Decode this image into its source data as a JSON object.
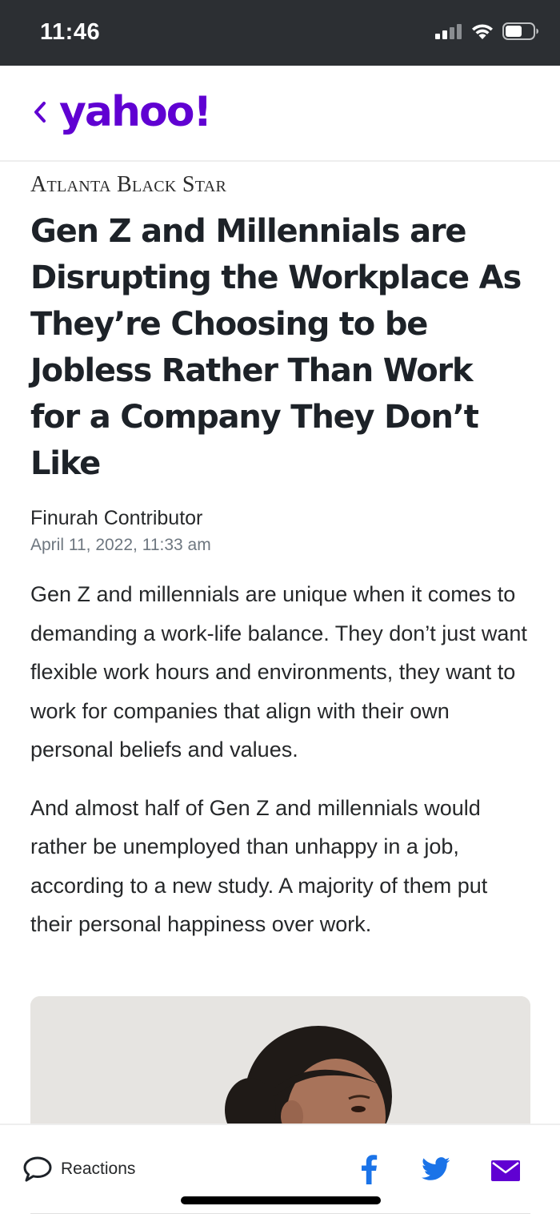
{
  "status_bar": {
    "time": "11:46"
  },
  "header": {
    "logo_text": "yahoo!",
    "brand_color": "#6001d2"
  },
  "article": {
    "publisher": "Atlanta Black Star",
    "headline": "Gen Z and Millennials are Disrupting the Workplace As They’re Choosing to be Jobless Rather Than Work for a Company They Don’t Like",
    "author": "Finurah Contributor",
    "date": "April 11, 2022, 11:33 am",
    "paragraphs": [
      "Gen Z and millennials are unique when it comes to demanding a work-life balance. They don’t just want flexible work hours and environments, they want to work for companies that align with their own personal beliefs and values.",
      "And almost half of Gen Z and millennials would rather be unemployed than unhappy in a job, according to a new study. A majority of them put their personal happiness over work."
    ]
  },
  "bottom_bar": {
    "reactions_label": "Reactions",
    "icons": [
      "comment-icon",
      "facebook-icon",
      "twitter-icon",
      "mail-icon"
    ],
    "share_color": "#1a73e8",
    "mail_color": "#6001d2"
  }
}
